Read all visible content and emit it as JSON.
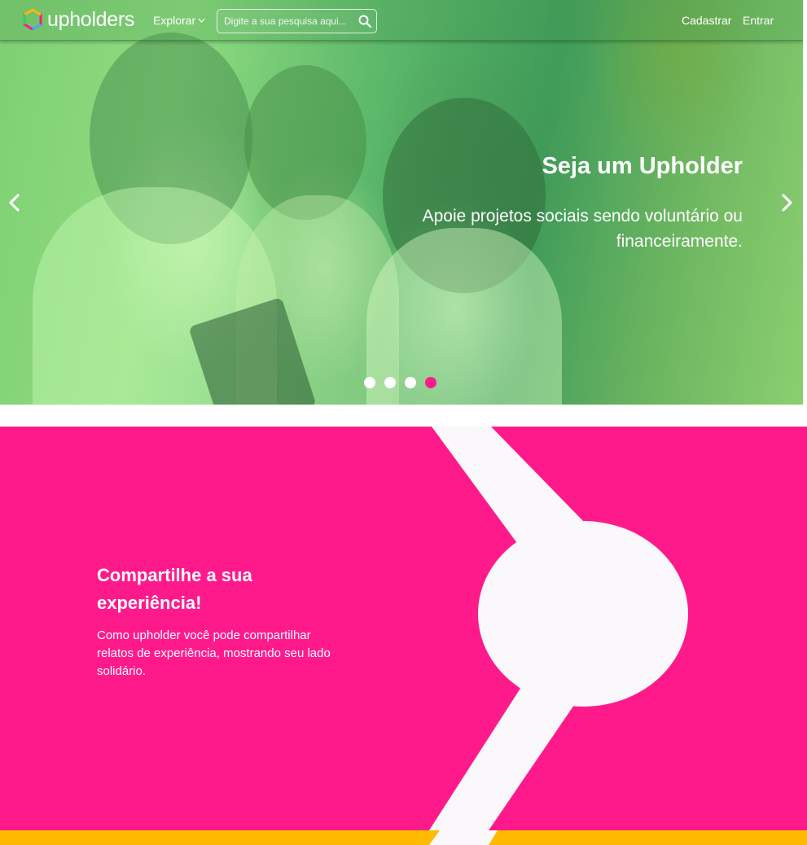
{
  "header": {
    "logo_text": "upholders",
    "explore_label": "Explorar",
    "search_placeholder": "Digite a sua pesquisa aqui...",
    "signup_label": "Cadastrar",
    "login_label": "Entrar"
  },
  "hero": {
    "title": "Seja um Upholder",
    "subtitle": "Apoie projetos sociais sendo voluntário ou financeiramente.",
    "slides_count": 4,
    "active_slide": 4
  },
  "feature": {
    "title": "Compartilhe a sua experiência!",
    "text": "Como upholder você pode compartilhar relatos de experiência, mostrando seu lado solidário."
  },
  "colors": {
    "pink": "#ff1a8c",
    "yellow": "#ffbb00",
    "hero_overlay": "#5cb86a"
  }
}
